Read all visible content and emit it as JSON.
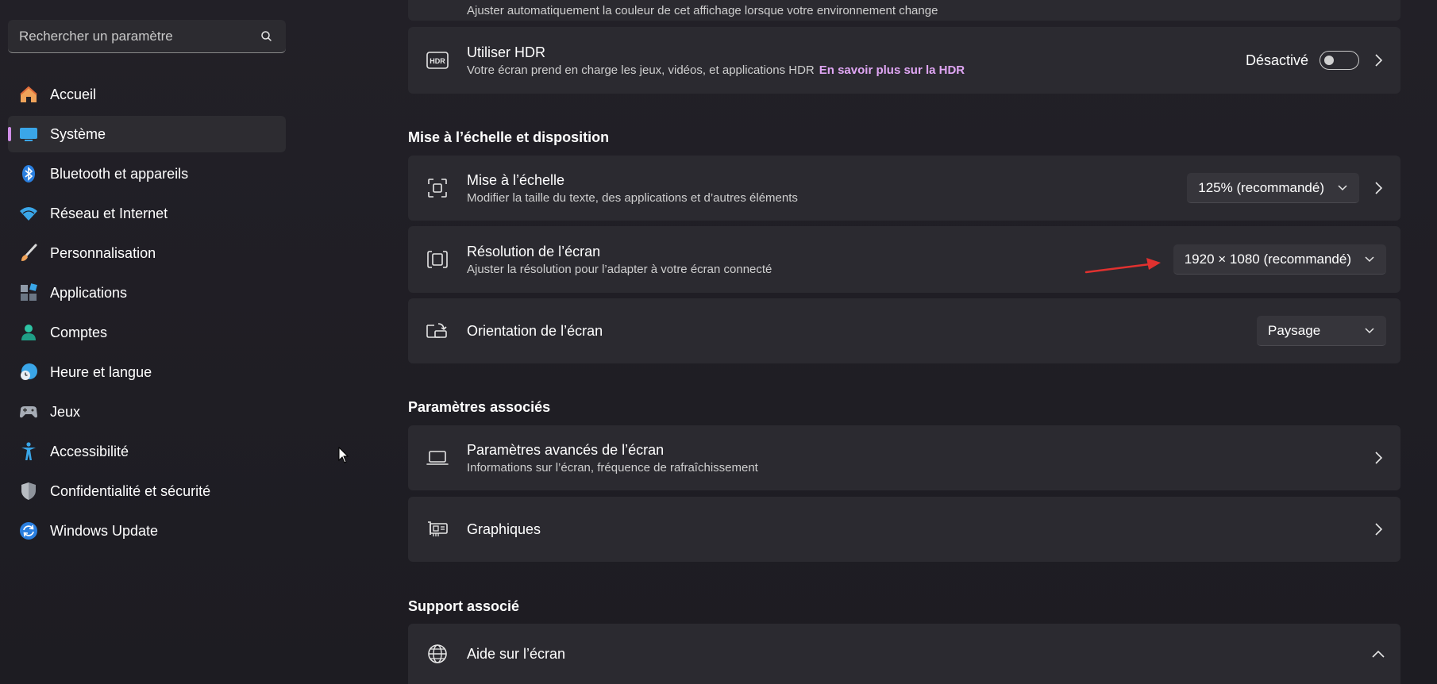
{
  "sidebar": {
    "search_placeholder": "Rechercher un paramètre",
    "items": [
      {
        "label": "Accueil",
        "icon": "home-icon"
      },
      {
        "label": "Système",
        "icon": "monitor-icon",
        "active": true
      },
      {
        "label": "Bluetooth et appareils",
        "icon": "bluetooth-icon"
      },
      {
        "label": "Réseau et Internet",
        "icon": "wifi-icon"
      },
      {
        "label": "Personnalisation",
        "icon": "brush-icon"
      },
      {
        "label": "Applications",
        "icon": "apps-icon"
      },
      {
        "label": "Comptes",
        "icon": "account-icon"
      },
      {
        "label": "Heure et langue",
        "icon": "globe-clock-icon"
      },
      {
        "label": "Jeux",
        "icon": "gamepad-icon"
      },
      {
        "label": "Accessibilité",
        "icon": "accessibility-icon"
      },
      {
        "label": "Confidentialité et sécurité",
        "icon": "shield-icon"
      },
      {
        "label": "Windows Update",
        "icon": "update-icon"
      }
    ]
  },
  "main": {
    "top_partial_sub": "Ajuster automatiquement la couleur de cet affichage lorsque votre environnement change",
    "hdr": {
      "title": "Utiliser HDR",
      "sub": "Votre écran prend en charge les jeux, vidéos, et applications HDR",
      "link": "En savoir plus sur la HDR",
      "status": "Désactivé"
    },
    "section_scale": "Mise à l’échelle et disposition",
    "scale": {
      "title": "Mise à l’échelle",
      "sub": "Modifier la taille du texte, des applications et d’autres éléments",
      "value": "125% (recommandé)"
    },
    "resolution": {
      "title": "Résolution de l’écran",
      "sub": "Ajuster la résolution pour l’adapter à  votre  écran connecté",
      "value": "1920 × 1080 (recommandé)"
    },
    "orientation": {
      "title": "Orientation de l’écran",
      "value": "Paysage"
    },
    "section_related": "Paramètres associés",
    "advanced": {
      "title": "Paramètres avancés de l’écran",
      "sub": "Informations sur l’écran, fréquence de rafraîchissement"
    },
    "graphics": {
      "title": "Graphiques"
    },
    "section_support": "Support associé",
    "help": {
      "title": "Aide sur l’écran"
    }
  },
  "colors": {
    "accent": "#d08ee8",
    "link": "#e0a6f4",
    "annotation_arrow": "#e0312f",
    "card": "#2b2a30"
  }
}
